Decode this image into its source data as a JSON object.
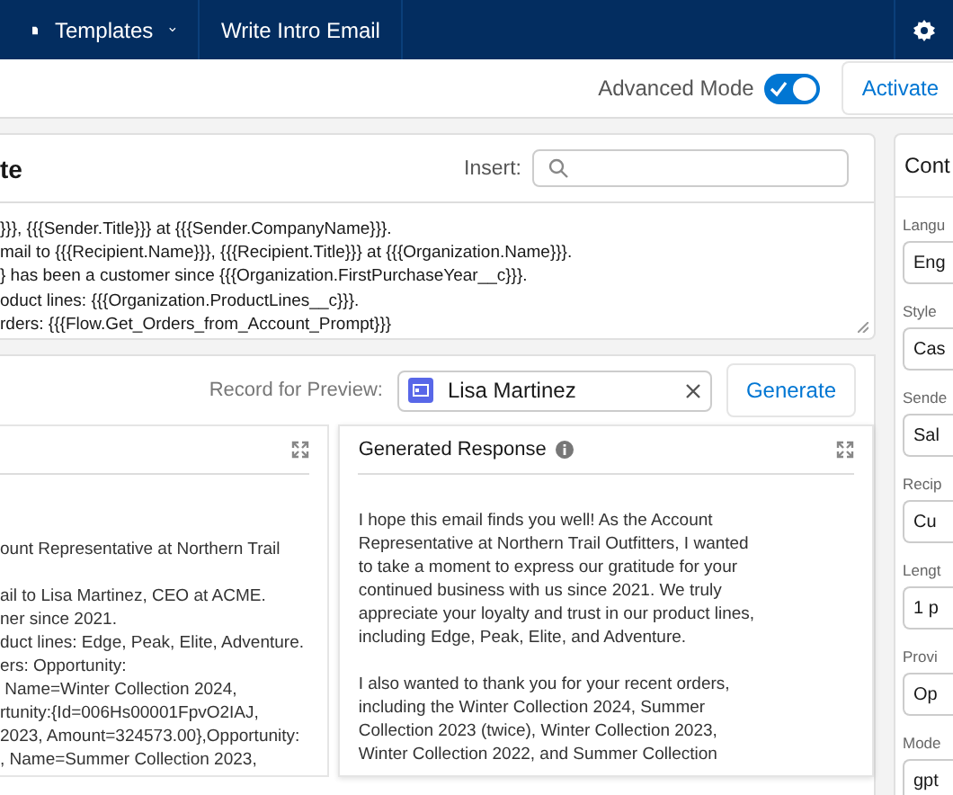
{
  "nav": {
    "tabs": [
      {
        "label": "Templates",
        "kind": "dropdown"
      },
      {
        "label": "Write Intro Email",
        "kind": "plain"
      }
    ]
  },
  "toolbar": {
    "advanced_mode": {
      "label": "Advanced Mode",
      "on": true
    },
    "activate_button": "Activate"
  },
  "editor": {
    "title": "te",
    "insert_label": "Insert:",
    "prompt_lines": [
      "}}}, {{{Sender.Title}}} at {{{Sender.CompanyName}}}.",
      "mail to {{{Recipient.Name}}}, {{{Recipient.Title}}} at {{{Organization.Name}}}.",
      "} has been a customer since {{{Organization.FirstPurchaseYear__c}}}.",
      "oduct lines: {{{Organization.ProductLines__c}}}.",
      "rders: {{{Flow.Get_Orders_from_Account_Prompt}}}"
    ]
  },
  "preview": {
    "record_label": "Record for Preview:",
    "record_value": "Lisa Martinez",
    "generate_button": "Generate",
    "resolved_blocks": [
      [
        "ount Representative at Northern Trail"
      ],
      [
        "ail to Lisa Martinez, CEO at ACME.",
        "ner since 2021.",
        "duct lines: Edge, Peak, Elite, Adventure.",
        "ers: Opportunity:",
        " Name=Winter Collection 2024,",
        "rtunity:{Id=006Hs00001FpvO2IAJ,",
        "2023, Amount=324573.00},Opportunity:",
        ", Name=Summer Collection 2023,"
      ]
    ],
    "response_title": "Generated Response",
    "response_paragraphs": [
      [
        "I hope this email finds you well! As the Account",
        "Representative at Northern Trail Outfitters, I wanted",
        "to take a moment to express our gratitude for your",
        "continued business with us since 2021. We truly",
        "appreciate your loyalty and trust in our product lines,",
        "including Edge, Peak, Elite, and Adventure."
      ],
      [
        "I also wanted to thank you for your recent orders,",
        "including the Winter Collection 2024, Summer",
        "Collection 2023 (twice), Winter Collection 2023,",
        "Winter Collection 2022, and Summer Collection"
      ]
    ]
  },
  "config": {
    "title": "Cont",
    "fields": [
      {
        "label": "Langu",
        "value": "Eng"
      },
      {
        "label": "Style",
        "value": "Cas"
      },
      {
        "label": "Sende",
        "value": "Sal"
      },
      {
        "label": "Recip",
        "value": "Cu"
      },
      {
        "label": "Lengt",
        "value": "1 p"
      },
      {
        "label": "Provi",
        "value": "Op"
      },
      {
        "label": "Mode",
        "value": "gpt"
      }
    ]
  }
}
